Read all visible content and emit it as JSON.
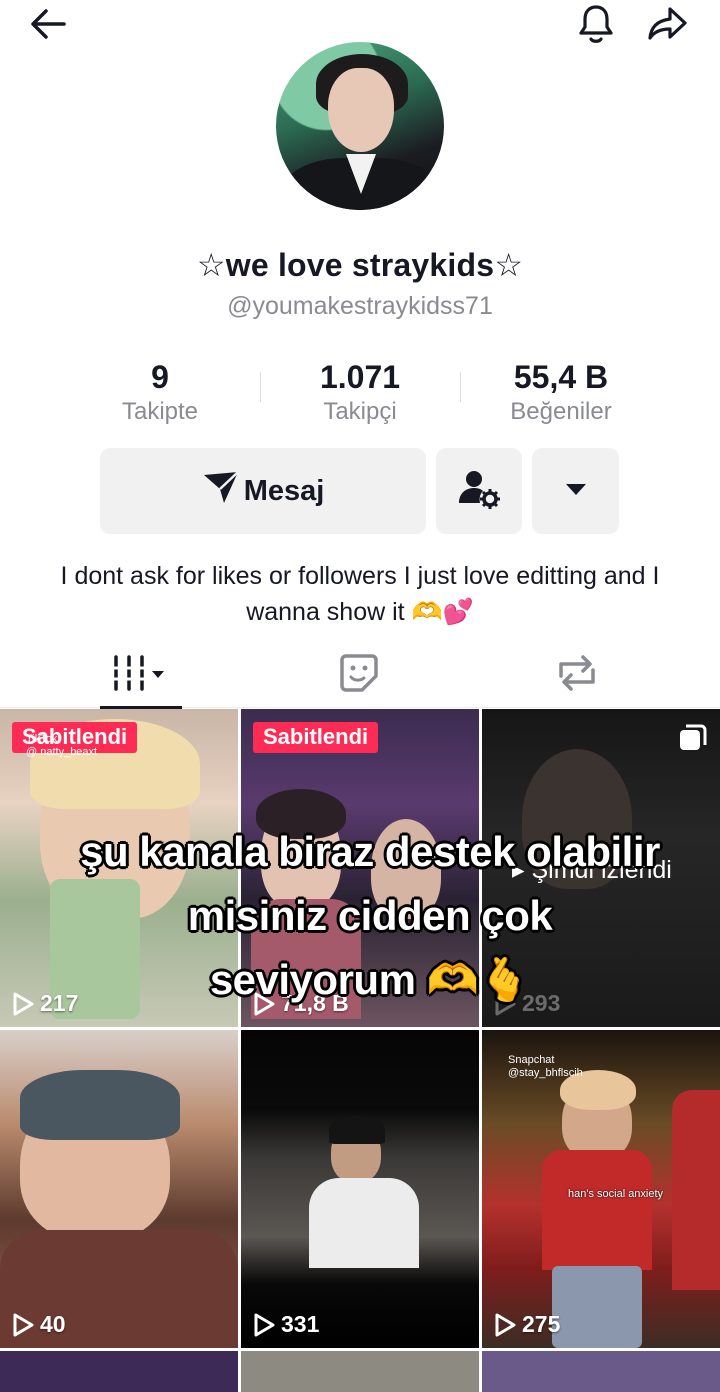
{
  "profile": {
    "display_name": "☆we love straykids☆",
    "username": "@youmakestraykidss71",
    "bio": "I dont ask for likes or followers I just love editting and I wanna show it 🫶💕"
  },
  "stats": [
    {
      "value": "9",
      "label": "Takipte"
    },
    {
      "value": "1.071",
      "label": "Takipçi"
    },
    {
      "value": "55,4 B",
      "label": "Beğeniler"
    }
  ],
  "actions": {
    "message_label": "Mesaj"
  },
  "caption": "şu kanala biraz destek olabilir misiniz cidden çok seviyorum 🫶🫰",
  "videos": [
    {
      "badge": "Sabitlendi",
      "views": "217",
      "watermark": "TikTok\n@ natty_beaxt"
    },
    {
      "badge": "Sabitlendi",
      "views": "71,8 B"
    },
    {
      "status": "Şimdi izlendi",
      "views": "293"
    },
    {
      "views": "40"
    },
    {
      "views": "331"
    },
    {
      "views": "275",
      "watermark": "Snapchat\n@stay_bhflscih",
      "overlay_text": "han's social anxiety"
    }
  ],
  "colors": {
    "badge": "#fe2c55",
    "text_primary": "#161823",
    "text_secondary": "#8a8b91",
    "button_bg": "#f1f1f2"
  },
  "icons": [
    "back-arrow-icon",
    "bell-icon",
    "share-icon",
    "send-icon",
    "add-friend-icon",
    "dropdown-icon",
    "grid-icon",
    "liked-icon",
    "repost-icon",
    "play-icon",
    "multi-photo-icon"
  ]
}
